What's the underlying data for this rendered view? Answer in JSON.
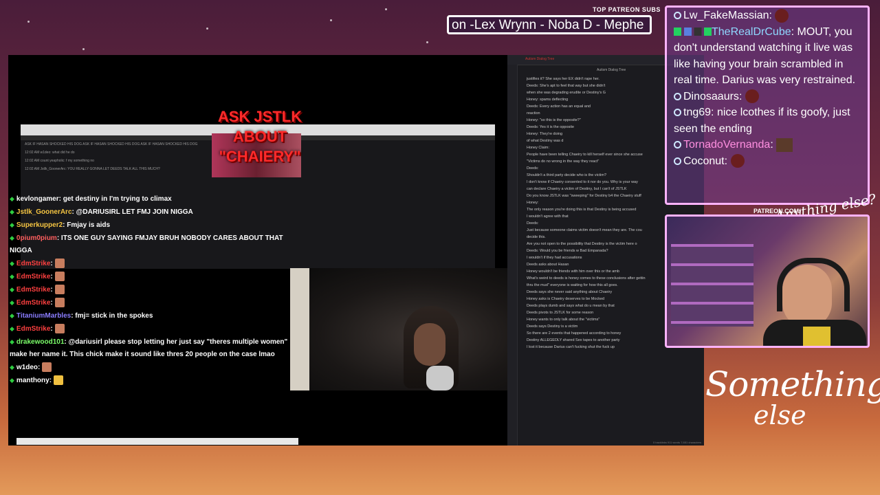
{
  "overlay": {
    "patreon_header": "TOP PATREON SUBS",
    "ticker_text": "on -Lex Wrynn -  Noba D - Mephe",
    "patreon_url": "PATREON.COM/",
    "brand_line1": "Something",
    "brand_line2": "else",
    "cursive_logo": "Anything else?"
  },
  "stream": {
    "ask_text": "ASK JSTLK ABOUT \"CHAIERY\"",
    "chat": [
      {
        "user": "kevlongamer",
        "user_color": "#ffffff",
        "text": ": get destiny in I'm trying to climax"
      },
      {
        "user": "Jstlk_GoonerArc",
        "user_color": "#f5c542",
        "text": ": @DARIUSIRL LET FMJ JOIN NIGGA"
      },
      {
        "user": "Superkupper2",
        "user_color": "#f5c542",
        "text": ": Fmjay is aids"
      },
      {
        "user": "0pium0pium",
        "user_color": "#ff5f5f",
        "text": ": ITS ONE GUY SAYING FMJAY BRUH NOBODY CARES ABOUT THAT NIGGA"
      },
      {
        "user": "EdmStrike",
        "user_color": "#ff4040",
        "text": ":"
      },
      {
        "user": "EdmStrike",
        "user_color": "#ff4040",
        "text": ":"
      },
      {
        "user": "EdmStrike",
        "user_color": "#ff4040",
        "text": ":"
      },
      {
        "user": "EdmStrike",
        "user_color": "#ff4040",
        "text": ":"
      },
      {
        "user": "TitaniumMarbles",
        "user_color": "#8a7dff",
        "text": ": fmj= stick in the spokes"
      },
      {
        "user": "EdmStrike",
        "user_color": "#ff4040",
        "text": ":"
      },
      {
        "user": "drakewood101",
        "user_color": "#7cff6a",
        "text": ": @dariusirl please stop letting her just say \"theres multiple women\" make her name it. This chick make it sound like thres 20 people on the case lmao"
      },
      {
        "user": "w1deo",
        "user_color": "#ffffff",
        "text": ":"
      },
      {
        "user": "manthony",
        "user_color": "#ffffff",
        "text": ":"
      }
    ]
  },
  "notes": {
    "tab_label": "Autism Dialog Tree",
    "title": "Autism Dialog Tree",
    "lines": [
      "justifies it? She says her EX didn't rape her.",
      "   Deeds: She's apt to feel that way but she didn't",
      "   when she was degrading erudite or Destiny's G",
      "      Honey: spams deflecting",
      "         Deeds: Every action has an equal and",
      "         reaction",
      "            Honey: \"so this is the opposite?\"",
      "               Deeds: Yes it is the opposite",
      "                  Honey: They're doing",
      "                  of what Destiny was d",
      "",
      "Honey Claim:",
      "  People have been telling Chaeiry to kill herself ever since she accuse",
      "  \"Victims do no wrong in the way they react\"",
      "",
      "Deeds:",
      "  Shouldn't a third party decide who is the victim?",
      "  I don't know if Chaeiry consented to it nor do you. Why is your way",
      "  can declare Chaeiry a victim of Destiny, but I can't of JSTLK",
      "  Do you know JSTLK was \"sweeping\" for Destiny b4 the Chaeiry stuff",
      "Honey:",
      "  The only reason you're doing this is that Destiny is being accused",
      "  I wouldn't agree with that",
      "Deeds:",
      "  Just because someone claims victim doesn't mean they are. The cou",
      "  decide this.",
      "  Are you not open to the possibility that Destiny is the victim here o",
      "",
      "Deeds: Would you be friends w Bad Empanada?",
      "  I wouldn't if they had accusations",
      "     Deeds asks about Hasan",
      "        Honey wouldn't be friends with him over this or the amb",
      "",
      "What's weird to deeds is honey comes to these conclusions after gettin",
      "thru the mud\" everyone is waiting for how this all goes.",
      "  Deeds says she never said anything about Chaeiry",
      "  Honey asks is Chaeiry deserves to be Mocked",
      "  Deeds plays dumb and says what do u mean by that",
      "  Deeds pivots to JSTLK for some reason",
      "  Honey wants to only talk about the \"victims\"",
      "  Deeds says Destiny is a victim",
      "  So there are 2 events that happened according to honey",
      "     Destiny ALLEGEDLY shared Sex tapes to another party",
      "  I lost it because Darius can't fucking shut the fuck up"
    ],
    "footer": "0 backlinks   911 words  7,651 characters"
  },
  "right_chat": [
    {
      "user": "Lw_FakeMassian",
      "user_color": "#ffffff",
      "text": ":",
      "badges": false
    },
    {
      "user": "TheRealDrCube",
      "user_color": "#8fd8ff",
      "text": ": MOUT, you don't understand watching it live was like having your brain scrambled in real time. Darius was very restrained.",
      "badges": true
    },
    {
      "user": "Dinosaaurs",
      "user_color": "#ffffff",
      "text": ":",
      "badges": false
    },
    {
      "user": "tng69",
      "user_color": "#ffffff",
      "text": ":  nice lcothes if its goofy, just seen the ending",
      "badges": false
    },
    {
      "user": "TornadoVernanda",
      "user_color": "#ff8fe0",
      "text": ":",
      "badges": false
    },
    {
      "user": "Coconut",
      "user_color": "#ffffff",
      "text": ":",
      "badges": false
    }
  ]
}
